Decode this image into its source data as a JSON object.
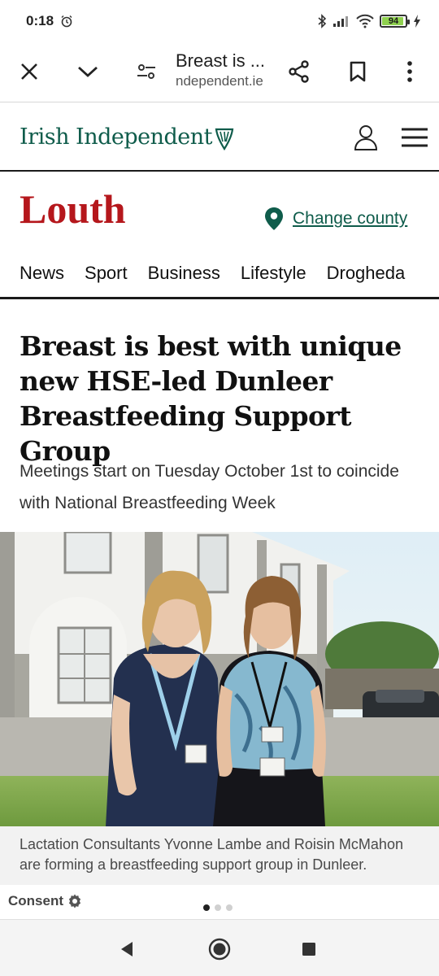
{
  "status_bar": {
    "time": "0:18",
    "battery_level": "94",
    "battery_color": "#8fd14f"
  },
  "browser": {
    "tab_title": "Breast is ...",
    "url": "ndependent.ie",
    "icons": [
      "close-icon",
      "chevron-down-icon",
      "page-settings-icon",
      "share-icon",
      "bookmark-icon",
      "more-icon"
    ]
  },
  "masthead": {
    "brand": "Irish Independent",
    "brand_color": "#0f5c4b",
    "icons": [
      "harp-icon",
      "account-icon",
      "menu-icon"
    ]
  },
  "county": {
    "name": "Louth",
    "name_color": "#b5171c",
    "change_label": "Change county"
  },
  "nav": {
    "items": [
      "News",
      "Sport",
      "Business",
      "Lifestyle",
      "Drogheda"
    ]
  },
  "article": {
    "headline": "Breast is best with unique new HSE-led Dunleer Breastfeeding Support Group",
    "standfirst": "Meetings start on Tuesday October 1st to coincide with National Breastfeeding Week",
    "caption": "Lactation Consultants Yvonne Lambe and Roisin McMahon are forming a breastfeeding support group in Dunleer."
  },
  "footer": {
    "consent_label": "Consent",
    "carousel_active_index": 0,
    "carousel_total": 3
  },
  "system_nav": {
    "icons": [
      "back-icon",
      "home-icon",
      "recents-icon"
    ]
  }
}
